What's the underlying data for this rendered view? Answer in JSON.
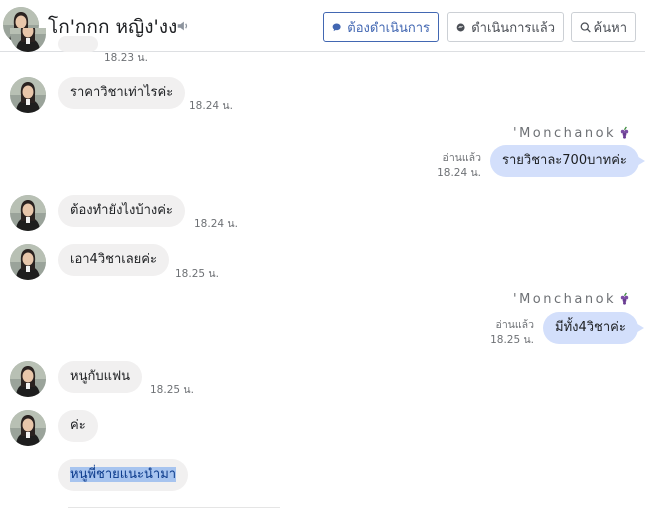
{
  "header": {
    "contact_name": "โก'กกก หญิง'งง",
    "buttons": {
      "follow_up": "ต้องดำเนินการ",
      "done": "ดำเนินการแล้ว",
      "search": "ค้นหา"
    }
  },
  "messages": {
    "top_ts": "18.23 น.",
    "m1": {
      "text": "ราคาวิชาเท่าไรค่ะ",
      "ts": "18.24 น."
    },
    "out1": {
      "sender": "'Monchanok",
      "status": "อ่านแล้ว",
      "ts": "18.24 น.",
      "text": "รายวิชาละ700บาทค่ะ"
    },
    "m2": {
      "text": "ต้องทำยังไงบ้างค่ะ",
      "ts": "18.24 น."
    },
    "m3": {
      "text": "เอา4วิชาเลยค่ะ",
      "ts": "18.25 น."
    },
    "out2": {
      "sender": "'Monchanok",
      "status": "อ่านแล้ว",
      "ts": "18.25 น.",
      "text": "มีทั้ง4วิชาค่ะ"
    },
    "m4": {
      "text": "หนูกับแฟน",
      "ts": "18.25 น."
    },
    "m5": {
      "text": "ค่ะ"
    },
    "m6": {
      "text": "หนูพี่ชายแนะนำมา"
    }
  },
  "colors": {
    "accent": "#4267b2",
    "outgoing_bubble": "#d3dffb",
    "incoming_bubble": "#f1f0f0"
  }
}
